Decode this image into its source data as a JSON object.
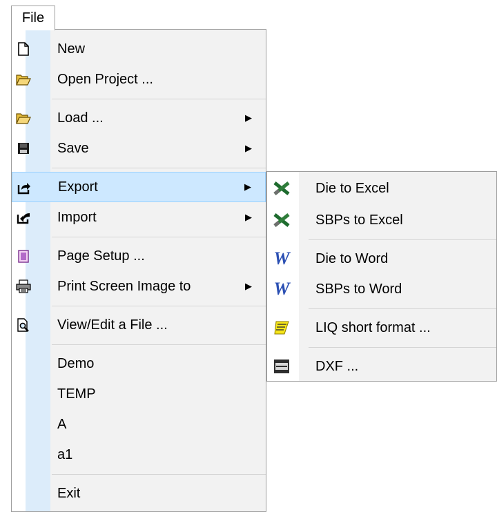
{
  "menubar": {
    "file_label": "File"
  },
  "file_menu": {
    "items": [
      {
        "label": "New",
        "icon": "new-document-icon"
      },
      {
        "label": "Open Project ...",
        "icon": "open-folder-icon"
      },
      {
        "label": "Load ...",
        "icon": "open-folder-icon",
        "has_submenu": true
      },
      {
        "label": "Save",
        "icon": "floppy-disk-icon",
        "has_submenu": true
      },
      {
        "label": "Export",
        "icon": "export-icon",
        "has_submenu": true,
        "active": true
      },
      {
        "label": "Import",
        "icon": "import-icon",
        "has_submenu": true
      },
      {
        "label": "Page Setup ...",
        "icon": "page-setup-icon"
      },
      {
        "label": "Print Screen Image to",
        "icon": "printer-icon",
        "has_submenu": true
      },
      {
        "label": "View/Edit a File ...",
        "icon": "view-file-icon"
      },
      {
        "label": "Demo"
      },
      {
        "label": "TEMP"
      },
      {
        "label": "A"
      },
      {
        "label": "a1"
      },
      {
        "label": "Exit"
      }
    ]
  },
  "export_submenu": {
    "items": [
      {
        "label": "Die to Excel",
        "icon": "excel-icon"
      },
      {
        "label": "SBPs to Excel",
        "icon": "excel-icon"
      },
      {
        "label": "Die to Word",
        "icon": "word-icon"
      },
      {
        "label": "SBPs to Word",
        "icon": "word-icon"
      },
      {
        "label": "LIQ short format ...",
        "icon": "liq-format-icon"
      },
      {
        "label": "DXF ...",
        "icon": "dxf-icon"
      }
    ]
  },
  "colors": {
    "menu_background": "#f2f2f2",
    "hover_background": "#cde8ff",
    "hover_border": "#99d1ff",
    "gutter_strip": "#dcecfa",
    "word_blue": "#2b4fb3"
  }
}
